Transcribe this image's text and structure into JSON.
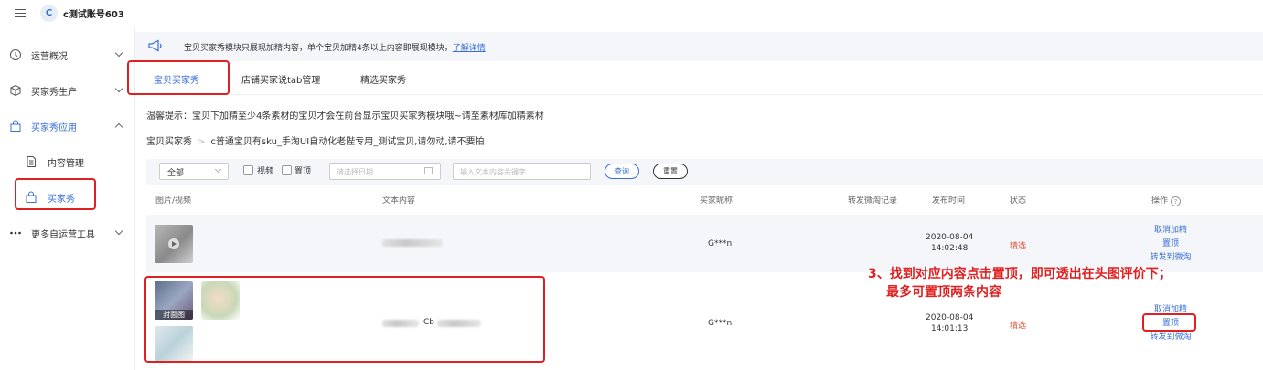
{
  "header": {
    "avatar_letter": "C",
    "account_name": "c测试账号603"
  },
  "sidebar": {
    "items": [
      {
        "label": "运营概况",
        "icon": "clock-icon"
      },
      {
        "label": "买家秀生产",
        "icon": "cube-icon"
      },
      {
        "label": "买家秀应用",
        "icon": "bag-icon"
      },
      {
        "label": "更多自运营工具",
        "icon": "more-dots-icon"
      }
    ],
    "subitems": [
      {
        "label": "内容管理",
        "icon": "document-icon"
      },
      {
        "label": "买家秀",
        "icon": "shopping-bag-icon"
      }
    ]
  },
  "notice": {
    "text": "宝贝买家秀模块只展现加精内容，单个宝贝加精4条以上内容即展现模块，",
    "link": "了解详情"
  },
  "tabs": [
    "宝贝买家秀",
    "店铺买家说tab管理",
    "精选买家秀"
  ],
  "tip": "温馨提示：宝贝下加精至少4条素材的宝贝才会在前台显示宝贝买家秀模块哦~请至素材库加精素材",
  "breadcrumb": {
    "root": "宝贝买家秀",
    "current": "c普通宝贝有sku_手淘UI自动化老陛专用_测试宝贝,请勿动,请不要拍"
  },
  "filter": {
    "select_value": "全部",
    "video_label": "视频",
    "pinned_label": "置顶",
    "date_placeholder": "请选择日期",
    "keyword_placeholder": "输入文本内容关键字",
    "query_label": "查询",
    "reset_label": "重置"
  },
  "table": {
    "columns": [
      "图片/视频",
      "文本内容",
      "买家昵称",
      "转发微淘记录",
      "发布时间",
      "状态",
      "操作"
    ],
    "rows": [
      {
        "text_snippet": "",
        "buyer": "G***n",
        "date": "2020-08-04",
        "time": "14:02:48",
        "status": "精选",
        "actions": [
          "取消加精",
          "置顶",
          "转发到微淘"
        ]
      },
      {
        "text_snippet": "Cb",
        "buyer": "G***n",
        "date": "2020-08-04",
        "time": "14:01:13",
        "status": "精选",
        "cover_tag": "封面图",
        "actions": [
          "取消加精",
          "置顶",
          "转发到微淘"
        ]
      }
    ]
  },
  "annotation": {
    "line1": "3、找到对应内容点击置顶，即可透出在头图评价下；",
    "line2": "最多可置顶两条内容"
  },
  "colors": {
    "accent": "#3a6fd8",
    "highlight": "#e02020",
    "status": "#e04a2a"
  }
}
